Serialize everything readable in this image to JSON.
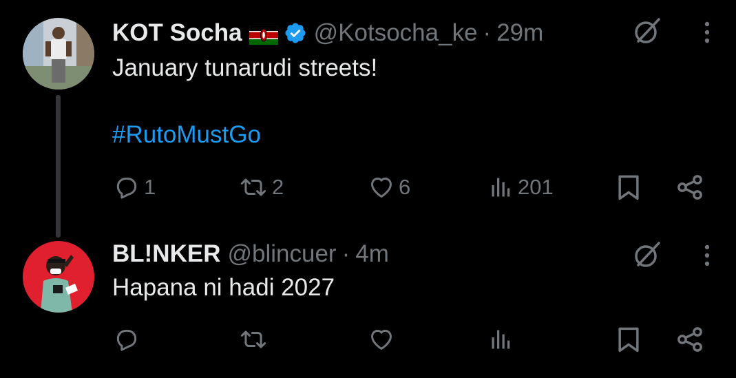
{
  "colors": {
    "background": "#000000",
    "text_primary": "#e7e9ea",
    "text_secondary": "#71767b",
    "link": "#1d9bf0",
    "verified": "#1d9bf0",
    "thread_line": "#333639"
  },
  "tweets": [
    {
      "display_name": "KOT Socha",
      "flag_emoji": "kenya-flag",
      "verified": true,
      "handle": "@Kotsocha_ke",
      "separator": "·",
      "time": "29m",
      "text_line1": "January tunarudi streets!",
      "hashtag": "#RutoMustGo",
      "reply_count": "1",
      "repost_count": "2",
      "like_count": "6",
      "view_count": "201"
    },
    {
      "display_name": "BL!NKER",
      "handle": "@blincuer",
      "separator": "·",
      "time": "4m",
      "text_line1": "Hapana ni hadi 2027",
      "reply_count": "",
      "repost_count": "",
      "like_count": "",
      "view_count": ""
    }
  ],
  "icons": {
    "reply": "reply-icon",
    "repost": "repost-icon",
    "like": "heart-icon",
    "views": "analytics-icon",
    "bookmark": "bookmark-icon",
    "share": "share-icon",
    "grok": "grok-icon",
    "more": "more-vertical-icon"
  }
}
